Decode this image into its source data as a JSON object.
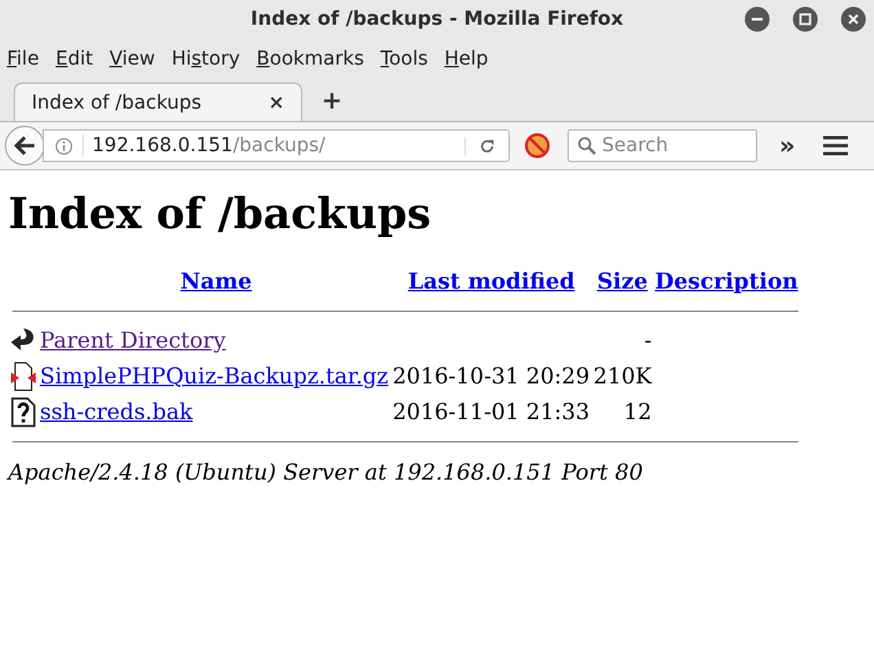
{
  "window": {
    "title": "Index of /backups - Mozilla Firefox"
  },
  "menu": [
    "File",
    "Edit",
    "View",
    "History",
    "Bookmarks",
    "Tools",
    "Help"
  ],
  "tabs": [
    {
      "label": "Index of /backups",
      "selected": true
    }
  ],
  "tab_close": "×",
  "new_tab": "+",
  "address": {
    "host": "192.168.0.151",
    "path": "/backups/"
  },
  "search": {
    "placeholder": "Search"
  },
  "overflow": "»",
  "page": {
    "heading": "Index of /backups",
    "columns": [
      "Name",
      "Last modified",
      "Size",
      "Description"
    ],
    "rows": [
      {
        "kind": "parent",
        "name": "Parent Directory",
        "visited": true,
        "size": "-"
      },
      {
        "kind": "archive",
        "name": "SimplePHPQuiz-Backupz.tar.gz",
        "visited": false,
        "modified": "2016-10-31 20:29",
        "size": "210K"
      },
      {
        "kind": "unknown",
        "name": "ssh-creds.bak",
        "visited": false,
        "modified": "2016-11-01 21:33",
        "size": "12"
      }
    ],
    "address": "Apache/2.4.18 (Ubuntu) Server at 192.168.0.151 Port 80"
  }
}
